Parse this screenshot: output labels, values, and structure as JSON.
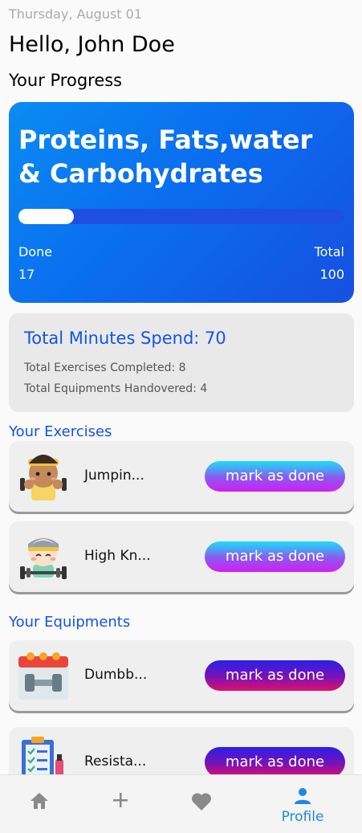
{
  "header": {
    "date": "Thursday, August 01",
    "greeting": "Hello, John Doe",
    "progress_title": "Your Progress"
  },
  "progress_card": {
    "heading": "Proteins, Fats,water & Carbohydrates",
    "done_label": "Done",
    "done_value": "17",
    "total_label": "Total",
    "total_value": "100",
    "progress_fraction": 0.17
  },
  "stats_card": {
    "minutes": "Total Minutes Spend: 70",
    "exercises_completed": "Total Exercises Completed: 8",
    "equipments_handovered": "Total Equipments Handovered: 4"
  },
  "exercises": {
    "title": "Your Exercises",
    "items": [
      {
        "name": "Jumpin...",
        "button": "mark as done",
        "icon": "exercise-avatar-icon"
      },
      {
        "name": "High Kn...",
        "button": "mark as done",
        "icon": "exercise-avatar-icon"
      }
    ]
  },
  "equipments": {
    "title": "Your Equipments",
    "items": [
      {
        "name": "Dumbb...",
        "button": "mark as done",
        "icon": "dumbbell-calendar-icon"
      },
      {
        "name": "Resista...",
        "button": "mark as done",
        "icon": "checklist-icon"
      }
    ]
  },
  "navbar": {
    "items": [
      {
        "icon": "home-icon",
        "label": ""
      },
      {
        "icon": "add-icon",
        "label": ""
      },
      {
        "icon": "heart-icon",
        "label": ""
      },
      {
        "icon": "profile-icon",
        "label": "Profile"
      }
    ],
    "active_color": "#1e88e5",
    "inactive_color": "#8a8a8a"
  },
  "colors": {
    "accent": "#1155e6",
    "card_gradient_start": "#0a8cf2",
    "card_gradient_end": "#1650e0"
  }
}
